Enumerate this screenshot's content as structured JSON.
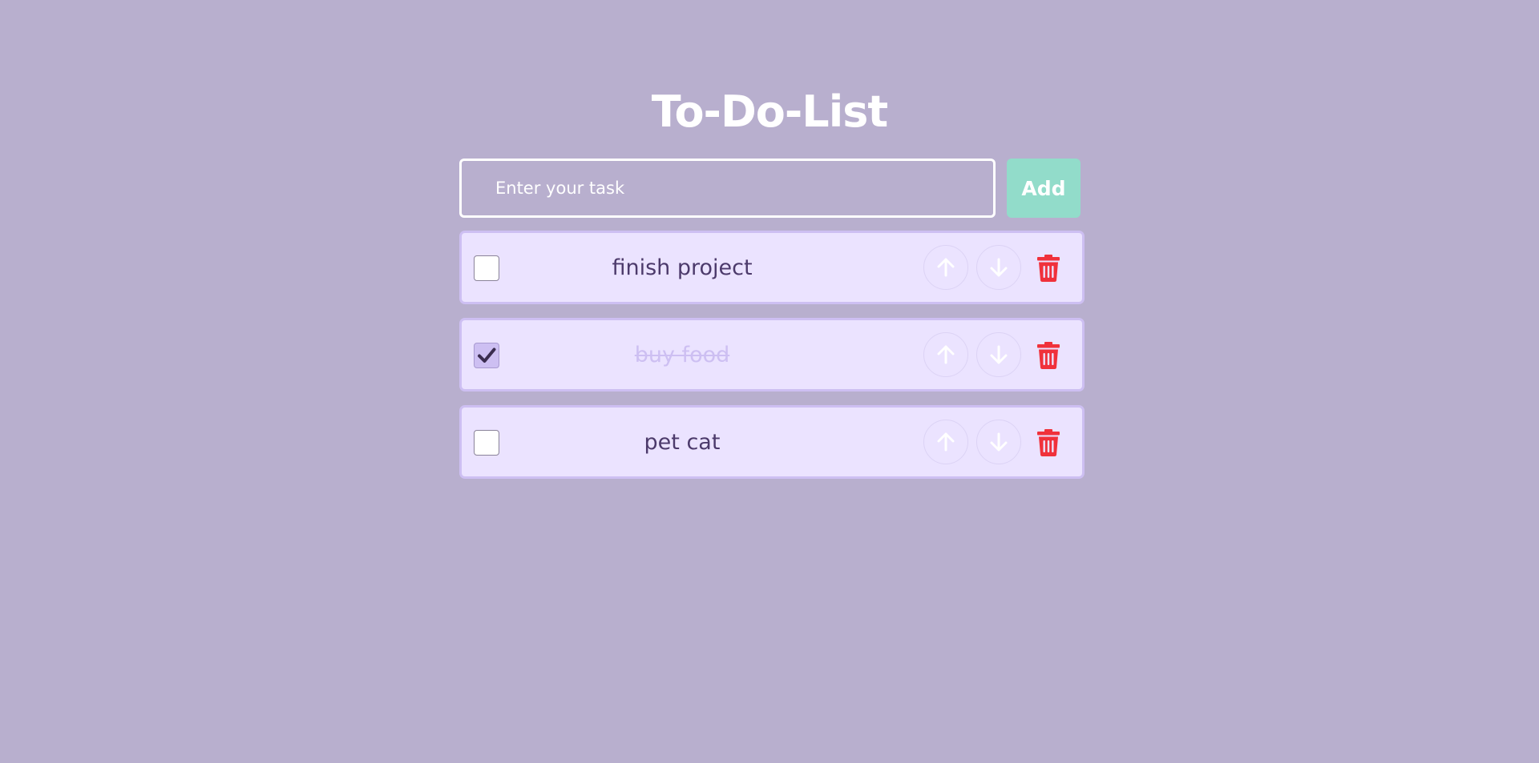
{
  "app": {
    "title": "To-Do-List"
  },
  "input": {
    "placeholder": "Enter your task",
    "value": ""
  },
  "add_button": {
    "label": "Add"
  },
  "tasks": [
    {
      "text": "finish project",
      "done": false
    },
    {
      "text": "buy food",
      "done": true
    },
    {
      "text": "pet cat",
      "done": false
    }
  ],
  "icons": {
    "move_up": "arrow-up-icon",
    "move_down": "arrow-down-icon",
    "delete": "trash-icon",
    "check": "checkmark-icon"
  },
  "colors": {
    "background": "#b8afce",
    "task_card": "#ebe3ff",
    "task_border": "#cdbff2",
    "task_text": "#4c3a6b",
    "done_text": "#cdbff2",
    "add_button": "#92dcca",
    "delete_icon": "#f0313b"
  }
}
